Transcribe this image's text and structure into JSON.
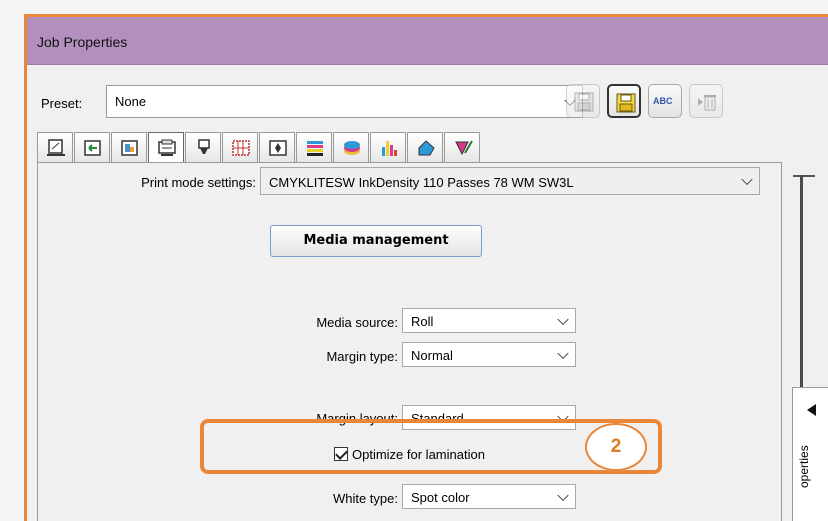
{
  "window": {
    "title": "Job Properties"
  },
  "preset": {
    "label": "Preset:",
    "value": "None"
  },
  "toolbar": {
    "buttons": [
      {
        "icon": "save-icon"
      },
      {
        "icon": "save-as-icon"
      },
      {
        "icon": "rename-icon",
        "text": "ABC"
      },
      {
        "icon": "delete-icon"
      }
    ]
  },
  "tabs": [
    {
      "icon": "document-icon"
    },
    {
      "icon": "import-icon"
    },
    {
      "icon": "image-icon"
    },
    {
      "icon": "printer-icon",
      "selected": true
    },
    {
      "icon": "nozzle-icon"
    },
    {
      "icon": "grid-icon"
    },
    {
      "icon": "position-icon"
    },
    {
      "icon": "color-bars-icon"
    },
    {
      "icon": "layers-icon"
    },
    {
      "icon": "ink-levels-icon"
    },
    {
      "icon": "shape-icon"
    },
    {
      "icon": "color-picker-icon"
    }
  ],
  "settings": {
    "print_mode_label": "Print mode settings:",
    "print_mode_value": "CMYKLITESW    InkDensity 110 Passes 78    WM SW3L",
    "media_management_label": "Media management",
    "media_source_label": "Media source:",
    "media_source_value": "Roll",
    "margin_type_label": "Margin type:",
    "margin_type_value": "Normal",
    "margin_layout_label": "Margin layout:",
    "margin_layout_value": "Standard",
    "optimize_label": "Optimize for lamination",
    "optimize_checked": true,
    "white_type_label": "White type:",
    "white_type_value": "Spot color"
  },
  "callout": {
    "number": "2",
    "color": "#e8863a"
  },
  "side_panel": {
    "label": "operties"
  },
  "colors": {
    "titlebar": "#b38fbd",
    "accent": "#e8863a"
  }
}
